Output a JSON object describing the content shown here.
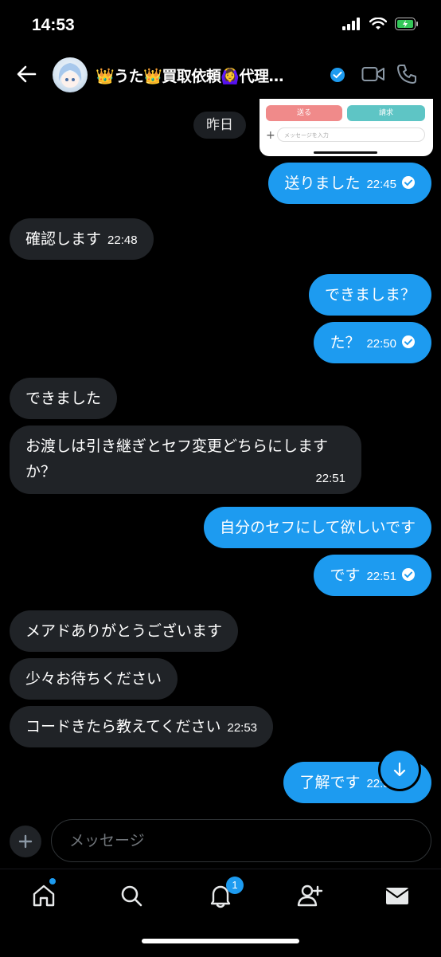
{
  "status": {
    "time": "14:53"
  },
  "header": {
    "title": "👑うた👑買取依頼🙆‍♀️代理…"
  },
  "thumbnail": {
    "send_label": "送る",
    "request_label": "請求",
    "input_placeholder": "メッセージを入力"
  },
  "day_label": "昨日",
  "messages": [
    {
      "dir": "out",
      "text": "送りました",
      "time": "22:45",
      "read": true
    },
    {
      "dir": "in",
      "text": "確認します",
      "time": "22:48"
    },
    {
      "dir": "out",
      "text": "できましま？",
      "time": ""
    },
    {
      "dir": "out",
      "text": "た？",
      "time": "22:50",
      "read": true
    },
    {
      "dir": "in",
      "text": "できました",
      "time": ""
    },
    {
      "dir": "in",
      "text": "お渡しは引き継ぎとセフ変更どちらにしますか？",
      "time": "22:51"
    },
    {
      "dir": "out",
      "text": "自分のセフにして欲しいです",
      "time": ""
    },
    {
      "dir": "out",
      "text": "です",
      "time": "22:51",
      "read": true
    },
    {
      "dir": "in",
      "text": "メアドありがとうございます",
      "time": ""
    },
    {
      "dir": "in",
      "text": "少々お待ちください",
      "time": ""
    },
    {
      "dir": "in",
      "text": "コードきたら教えてください",
      "time": "22:53"
    },
    {
      "dir": "out",
      "text": "了解です",
      "time": "22:53",
      "read": true
    }
  ],
  "composer": {
    "placeholder": "メッセージ"
  },
  "tabs": {
    "notifications_badge": "1"
  },
  "colors": {
    "accent": "#1d9bf0",
    "incoming_bubble": "#202327",
    "background": "#000000"
  }
}
